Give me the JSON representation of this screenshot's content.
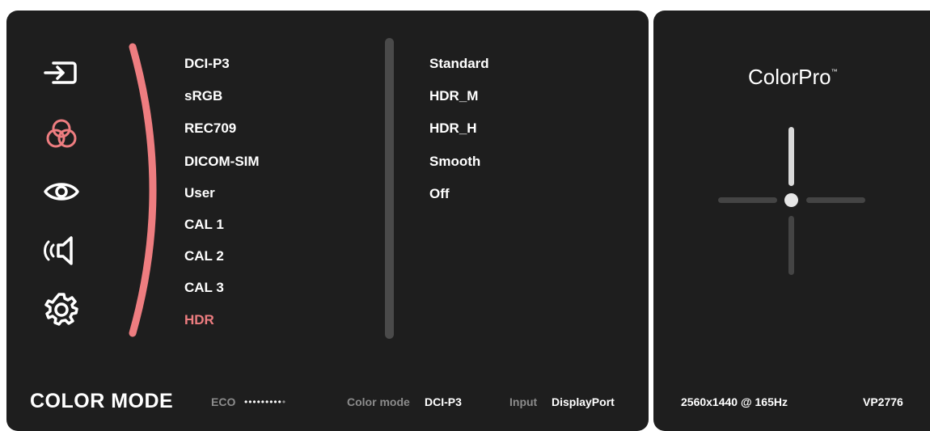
{
  "sidebar": {
    "icons": [
      {
        "name": "input-icon"
      },
      {
        "name": "color-adjust-icon"
      },
      {
        "name": "eye-icon"
      },
      {
        "name": "audio-icon"
      },
      {
        "name": "settings-gear-icon"
      }
    ],
    "active_icon_index": 1,
    "accent_color": "#ee7d80"
  },
  "menu": {
    "items": [
      "DCI-P3",
      "sRGB",
      "REC709",
      "DICOM-SIM",
      "User",
      "CAL 1",
      "CAL 2",
      "CAL 3",
      "HDR"
    ],
    "selected": "HDR"
  },
  "submenu": {
    "items": [
      "Standard",
      "HDR_M",
      "HDR_H",
      "Smooth",
      "Off"
    ]
  },
  "footer": {
    "title": "COLOR MODE",
    "eco_label": "ECO",
    "eco_dots": "•••••••••",
    "eco_dots_dim": "•",
    "color_mode_label": "Color mode",
    "color_mode_value": "DCI-P3",
    "input_label": "Input",
    "input_value": "DisplayPort"
  },
  "side": {
    "brand": "ColorPro",
    "brand_tm": "™",
    "resolution": "2560x1440 @ 165Hz",
    "model": "VP2776"
  }
}
